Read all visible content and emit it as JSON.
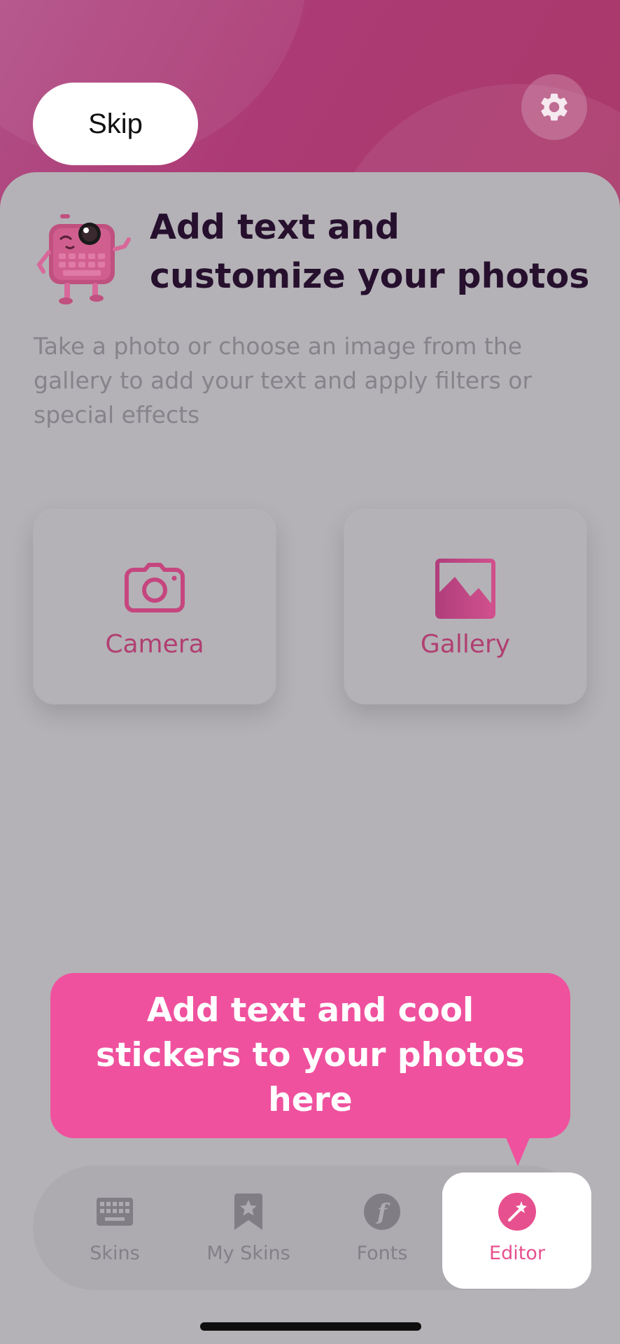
{
  "header": {
    "skip_label": "Skip",
    "settings_icon": "gear-icon"
  },
  "intro": {
    "title": "Add text and customize your photos",
    "description": "Take a photo or choose an image from the gallery to add your text and apply filters or special effects"
  },
  "sources": [
    {
      "label": "Camera",
      "icon": "camera-icon"
    },
    {
      "label": "Gallery",
      "icon": "image-icon"
    }
  ],
  "tooltip": {
    "text": "Add text and cool stickers to your photos here"
  },
  "tabs": [
    {
      "label": "Skins",
      "icon": "keyboard-icon"
    },
    {
      "label": "My Skins",
      "icon": "bookmark-star-icon"
    },
    {
      "label": "Fonts",
      "icon": "font-icon"
    },
    {
      "label": "Editor",
      "icon": "magic-wand-icon",
      "selected": true
    }
  ],
  "colors": {
    "accent": "#ef519e",
    "tile_label": "#b13f72",
    "title": "#26102e",
    "header_gradient_start": "#b24f87",
    "header_gradient_end": "#a93a6a"
  }
}
